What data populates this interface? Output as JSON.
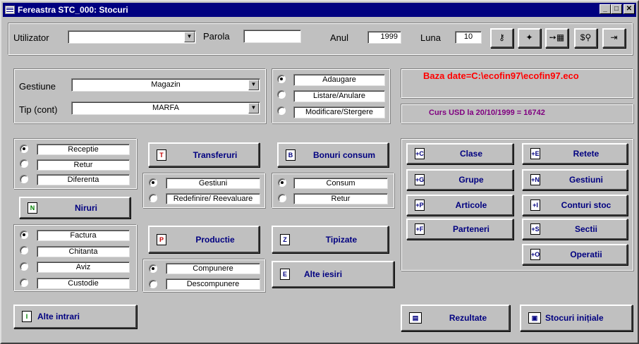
{
  "window": {
    "title": "Fereastra STC_000: Stocuri"
  },
  "top": {
    "user_label": "Utilizator",
    "user_value": "",
    "password_label": "Parola",
    "password_value": "",
    "year_label": "Anul",
    "year_value": "1999",
    "month_label": "Luna",
    "month_value": "10"
  },
  "selection": {
    "gestiune_label": "Gestiune",
    "gestiune_value": "Magazin",
    "tip_label": "Tip (cont)",
    "tip_value": "MARFA"
  },
  "mode_options": [
    "Adaugare",
    "Listare/Anulare",
    "Modificare/Stergere"
  ],
  "info": {
    "db_text": "Baza date=C:\\ecofin97\\ecofin97.eco",
    "db_color": "#ff0000",
    "curs_text": "Curs USD la 20/10/1999 =  16742",
    "curs_color": "#800080"
  },
  "intrari_options": [
    "Receptie",
    "Retur",
    "Diferenta"
  ],
  "niruri_label": "Niruri",
  "doc_options": [
    "Factura",
    "Chitanta",
    "Aviz",
    "Custodie"
  ],
  "alte_intrari_label": "Alte intrari",
  "transferuri_label": "Transferuri",
  "transfer_options": [
    "Gestiuni",
    "Redefinire/ Reevaluare"
  ],
  "productie_label": "Productie",
  "productie_options": [
    "Compunere",
    "Descompunere"
  ],
  "bonuri_label": "Bonuri consum",
  "bonuri_options": [
    "Consum",
    "Retur"
  ],
  "tipizate_label": "Tipizate",
  "alte_iesiri_label": "Alte iesiri",
  "nomenclator_left": [
    {
      "label": "Clase",
      "icon": "C"
    },
    {
      "label": "Grupe",
      "icon": "G"
    },
    {
      "label": "Articole",
      "icon": "P"
    },
    {
      "label": "Parteneri",
      "icon": "F"
    }
  ],
  "nomenclator_right": [
    {
      "label": "Retete",
      "icon": "E"
    },
    {
      "label": "Gestiuni",
      "icon": "N"
    },
    {
      "label": "Conturi stoc",
      "icon": "I"
    },
    {
      "label": "Sectii",
      "icon": "S"
    },
    {
      "label": "Operatii",
      "icon": "O"
    }
  ],
  "rezultate_label": "Rezultate",
  "stocuri_initiale_label": "Stocuri inițiale",
  "toolbar_icons": [
    "key-icon",
    "compass-icon",
    "calculator-icon",
    "search-money-icon",
    "exit-icon"
  ]
}
